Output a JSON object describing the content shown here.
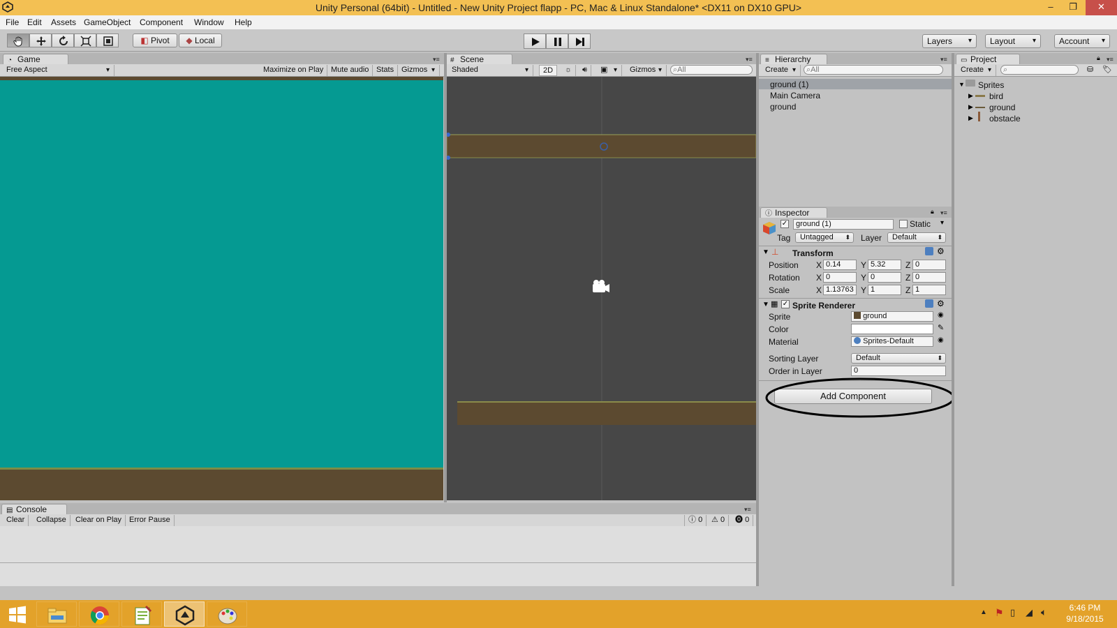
{
  "window": {
    "title": "Unity Personal (64bit) - Untitled - New Unity Project flapp - PC, Mac & Linux Standalone* <DX11 on DX10 GPU>",
    "minimize": "–",
    "restore": "❐",
    "close": "✕"
  },
  "menu": [
    "File",
    "Edit",
    "Assets",
    "GameObject",
    "Component",
    "Window",
    "Help"
  ],
  "toolbar": {
    "pivot": "Pivot",
    "local": "Local",
    "layers": "Layers",
    "layout": "Layout",
    "account": "Account"
  },
  "game": {
    "tab": "Game",
    "aspect": "Free Aspect",
    "maximize_on_play": "Maximize on Play",
    "mute_audio": "Mute audio",
    "stats": "Stats",
    "gizmos": "Gizmos"
  },
  "scene": {
    "tab": "Scene",
    "shading": "Shaded",
    "mode_2d": "2D",
    "gizmos": "Gizmos",
    "search_placeholder": "All"
  },
  "hierarchy": {
    "tab": "Hierarchy",
    "create": "Create",
    "search_placeholder": "All",
    "items": [
      "ground (1)",
      "Main Camera",
      "ground"
    ]
  },
  "project": {
    "tab": "Project",
    "create": "Create",
    "root": "Sprites",
    "items": [
      "bird",
      "ground",
      "obstacle"
    ]
  },
  "inspector": {
    "tab": "Inspector",
    "object_name": "ground (1)",
    "static_label": "Static",
    "tag_label": "Tag",
    "tag_value": "Untagged",
    "layer_label": "Layer",
    "layer_value": "Default",
    "transform": {
      "title": "Transform",
      "position_label": "Position",
      "rotation_label": "Rotation",
      "scale_label": "Scale",
      "x": "X",
      "y": "Y",
      "z": "Z",
      "position": {
        "x": "0.14",
        "y": "5.32",
        "z": "0"
      },
      "rotation": {
        "x": "0",
        "y": "0",
        "z": "0"
      },
      "scale": {
        "x": "1.13763",
        "y": "1",
        "z": "1"
      }
    },
    "sprite_renderer": {
      "title": "Sprite Renderer",
      "sprite_label": "Sprite",
      "sprite_value": "ground",
      "color_label": "Color",
      "material_label": "Material",
      "material_value": "Sprites-Default",
      "sorting_layer_label": "Sorting Layer",
      "sorting_layer_value": "Default",
      "order_label": "Order in Layer",
      "order_value": "0"
    },
    "add_component": "Add Component"
  },
  "console": {
    "tab": "Console",
    "clear": "Clear",
    "collapse": "Collapse",
    "clear_on_play": "Clear on Play",
    "error_pause": "Error Pause",
    "log_count": "0",
    "warning_count": "0",
    "error_count": "0"
  },
  "taskbar": {
    "time": "6:46 PM",
    "date": "9/18/2015"
  },
  "colors": {
    "titlebar": "#f3c053",
    "game_background": "#059a92",
    "ground": "#5c4a30",
    "scene_background": "#474747",
    "taskbar": "#e3a22a"
  }
}
